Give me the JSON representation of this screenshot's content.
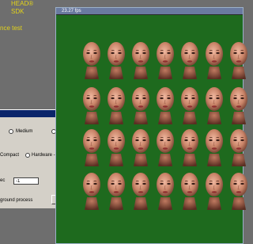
{
  "background": {
    "line1": "HEAD®",
    "line2": "SDK",
    "line3": "nce test"
  },
  "dialog": {
    "option_medium": "Medium",
    "option_compact": "Compact",
    "option_hardware": "Hardware -",
    "field_label": "ec",
    "field_value": "-1",
    "checkbox_label": "ground process"
  },
  "viewer": {
    "title": "23.27 fps"
  },
  "colors": {
    "desktop": "#6e6e6e",
    "viewer_bg": "#1e6a1e",
    "accent_text": "#e2d21a"
  }
}
